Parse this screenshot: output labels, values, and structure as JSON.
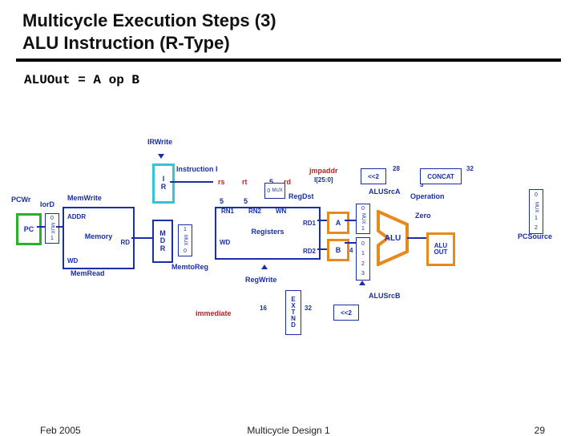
{
  "title_line1": "Multicycle Execution Steps (3)",
  "title_line2": "ALU Instruction (R-Type)",
  "expression": "ALUOut = A op B",
  "footer": {
    "date": "Feb 2005",
    "center": "Multicycle Design 1",
    "page": "29"
  },
  "signals": {
    "irwrite": "IRWrite",
    "pcwr": "PCWr",
    "iord": "IorD",
    "memwrite": "MemWrite",
    "memread": "MemRead",
    "memtoreg": "MemtoReg",
    "regdst": "RegDst",
    "regwrite": "RegWrite",
    "alusrcA": "ALUSrcA",
    "alusrcB": "ALUSrcB",
    "aluop": "Operation",
    "zero": "Zero",
    "pcsource": "PCSource"
  },
  "fields": {
    "instruction": "Instruction I",
    "rs": "rs",
    "rt": "rt",
    "rd": "rd",
    "immediate": "immediate",
    "jmpaddr": "jmpaddr",
    "i250": "I[25:0]"
  },
  "bits": {
    "b5a": "5",
    "b5b": "5",
    "b5c": "5",
    "b3": "3",
    "b16": "16",
    "b28": "28",
    "b32a": "32",
    "b32b": "32",
    "b4": "4"
  },
  "blocks": {
    "pc": "PC",
    "ir": "I\nR",
    "mdr": "M\nD\nR",
    "memory": "Memory",
    "addr": "ADDR",
    "rd": "RD",
    "wd": "WD",
    "registers": "Registers",
    "rn1": "RN1",
    "rn2": "RN2",
    "wn": "WN",
    "wd2": "WD",
    "rd1": "RD1",
    "rd2": "RD2",
    "a": "A",
    "b": "B",
    "alu": "ALU",
    "aluout": "ALU\nOUT",
    "extnd": "E\nX\nT\nN\nD",
    "sl2a": "<<2",
    "sl2b": "<<2",
    "concat": "CONCAT",
    "mux": "MUX",
    "m0": "0",
    "m1": "1",
    "m2": "2",
    "m3": "3"
  }
}
